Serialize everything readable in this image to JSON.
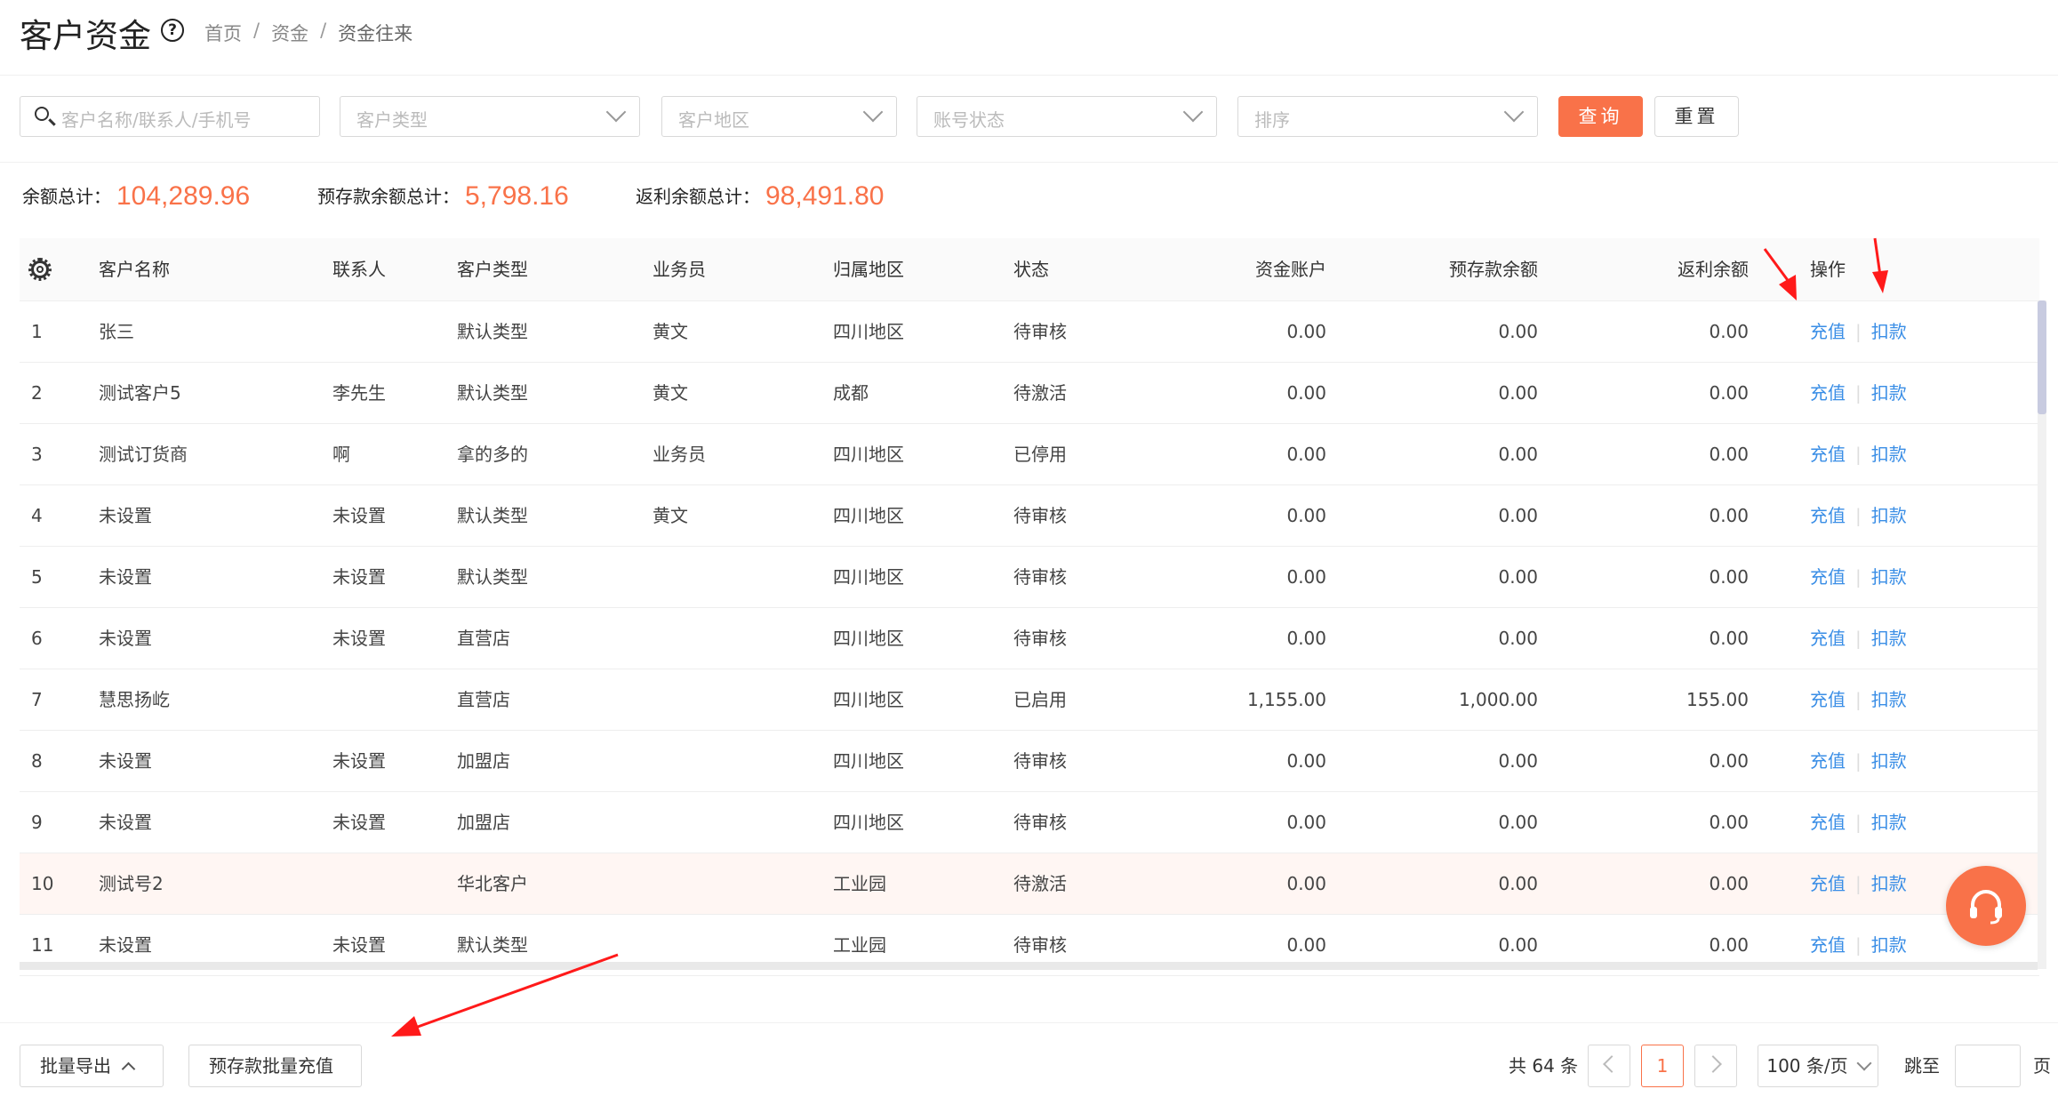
{
  "header": {
    "title": "客户资金",
    "help_icon": "?",
    "breadcrumb": [
      "首页",
      "资金",
      "资金往来"
    ]
  },
  "filters": {
    "search_placeholder": "客户名称/联系人/手机号",
    "customer_type_placeholder": "客户类型",
    "region_placeholder": "客户地区",
    "account_status_placeholder": "账号状态",
    "sort_placeholder": "排序",
    "query_label": "查询",
    "reset_label": "重置"
  },
  "totals": {
    "balance_label": "余额总计：",
    "balance_value": "104,289.96",
    "prepaid_label": "预存款余额总计：",
    "prepaid_value": "5,798.16",
    "rebate_label": "返利余额总计：",
    "rebate_value": "98,491.80"
  },
  "table": {
    "columns": [
      "客户名称",
      "联系人",
      "客户类型",
      "业务员",
      "归属地区",
      "状态",
      "资金账户",
      "预存款余额",
      "返利余额",
      "操作"
    ],
    "recharge_label": "充值",
    "deduct_label": "扣款",
    "rows": [
      {
        "no": "1",
        "name": "张三",
        "contact": "",
        "type": "默认类型",
        "sales": "黄文",
        "region": "四川地区",
        "status": "待审核",
        "account": "0.00",
        "prepaid": "0.00",
        "rebate": "0.00"
      },
      {
        "no": "2",
        "name": "测试客户5",
        "contact": "李先生",
        "type": "默认类型",
        "sales": "黄文",
        "region": "成都",
        "status": "待激活",
        "account": "0.00",
        "prepaid": "0.00",
        "rebate": "0.00"
      },
      {
        "no": "3",
        "name": "测试订货商",
        "contact": "啊",
        "type": "拿的多的",
        "sales": "业务员",
        "region": "四川地区",
        "status": "已停用",
        "account": "0.00",
        "prepaid": "0.00",
        "rebate": "0.00"
      },
      {
        "no": "4",
        "name": "未设置",
        "contact": "未设置",
        "type": "默认类型",
        "sales": "黄文",
        "region": "四川地区",
        "status": "待审核",
        "account": "0.00",
        "prepaid": "0.00",
        "rebate": "0.00"
      },
      {
        "no": "5",
        "name": "未设置",
        "contact": "未设置",
        "type": "默认类型",
        "sales": "",
        "region": "四川地区",
        "status": "待审核",
        "account": "0.00",
        "prepaid": "0.00",
        "rebate": "0.00"
      },
      {
        "no": "6",
        "name": "未设置",
        "contact": "未设置",
        "type": "直营店",
        "sales": "",
        "region": "四川地区",
        "status": "待审核",
        "account": "0.00",
        "prepaid": "0.00",
        "rebate": "0.00"
      },
      {
        "no": "7",
        "name": "慧思扬屹",
        "contact": "",
        "type": "直营店",
        "sales": "",
        "region": "四川地区",
        "status": "已启用",
        "account": "1,155.00",
        "prepaid": "1,000.00",
        "rebate": "155.00"
      },
      {
        "no": "8",
        "name": "未设置",
        "contact": "未设置",
        "type": "加盟店",
        "sales": "",
        "region": "四川地区",
        "status": "待审核",
        "account": "0.00",
        "prepaid": "0.00",
        "rebate": "0.00"
      },
      {
        "no": "9",
        "name": "未设置",
        "contact": "未设置",
        "type": "加盟店",
        "sales": "",
        "region": "四川地区",
        "status": "待审核",
        "account": "0.00",
        "prepaid": "0.00",
        "rebate": "0.00"
      },
      {
        "no": "10",
        "name": "测试号2",
        "contact": "",
        "type": "华北客户",
        "sales": "",
        "region": "工业园",
        "status": "待激活",
        "account": "0.00",
        "prepaid": "0.00",
        "rebate": "0.00"
      },
      {
        "no": "11",
        "name": "未设置",
        "contact": "未设置",
        "type": "默认类型",
        "sales": "",
        "region": "工业园",
        "status": "待审核",
        "account": "0.00",
        "prepaid": "0.00",
        "rebate": "0.00"
      }
    ]
  },
  "footer": {
    "batch_export_label": "批量导出",
    "batch_recharge_label": "预存款批量充值",
    "total_text": "共 64 条",
    "current_page": "1",
    "page_size": "100 条/页",
    "jump_label": "跳至",
    "page_suffix": "页"
  },
  "colors": {
    "accent": "#f97249",
    "link": "#3a8ee6",
    "annotation_arrow": "#ff1a1a"
  },
  "icons": [
    "help-icon",
    "search-icon",
    "chevron-down-icon",
    "gear-icon",
    "headset-icon",
    "chevron-up-icon",
    "chevron-left-icon",
    "chevron-right-icon"
  ]
}
